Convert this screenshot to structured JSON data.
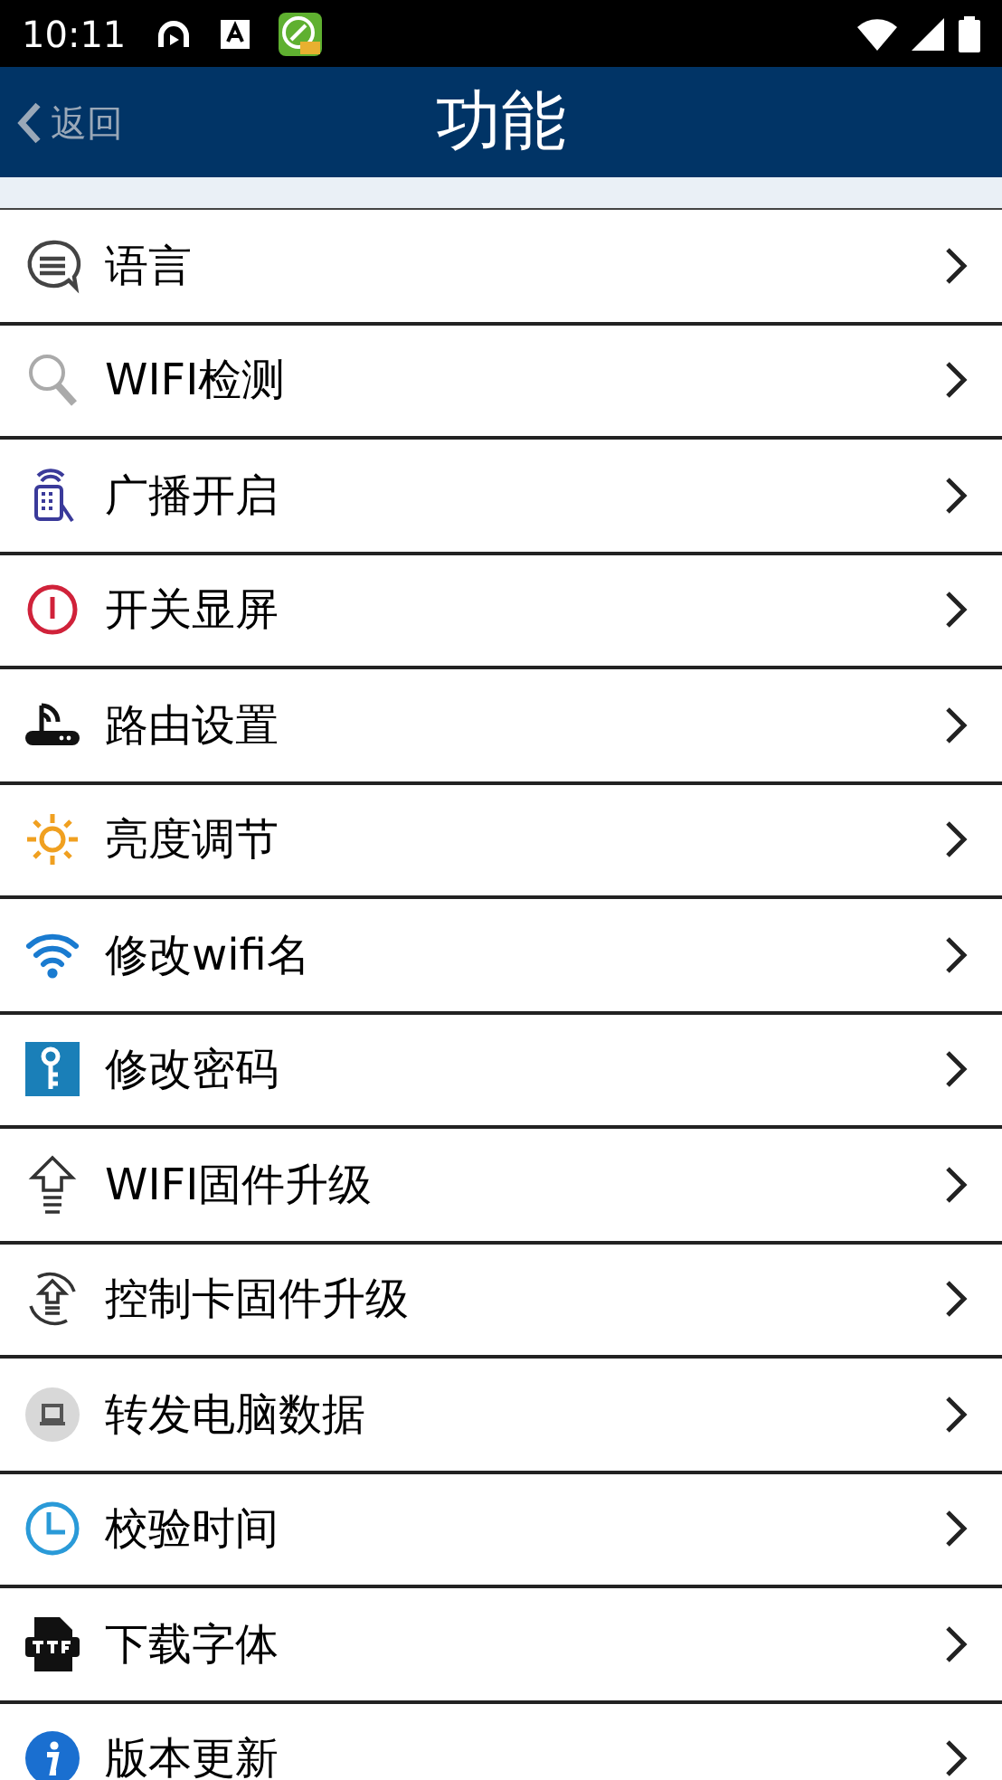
{
  "status_bar": {
    "time": "10:11"
  },
  "nav": {
    "back": "返回",
    "title": "功能"
  },
  "items": [
    {
      "kind": "chat",
      "label": "语言"
    },
    {
      "kind": "search",
      "label": "WIFI检测"
    },
    {
      "kind": "broadcast",
      "label": "广播开启"
    },
    {
      "kind": "power",
      "label": "开关显屏"
    },
    {
      "kind": "router",
      "label": "路由设置"
    },
    {
      "kind": "sun",
      "label": "亮度调节"
    },
    {
      "kind": "wifi",
      "label": "修改wifi名"
    },
    {
      "kind": "key",
      "label": "修改密码"
    },
    {
      "kind": "upload",
      "label": "WIFI固件升级"
    },
    {
      "kind": "sync",
      "label": "控制卡固件升级"
    },
    {
      "kind": "monitor",
      "label": "转发电脑数据"
    },
    {
      "kind": "clock",
      "label": "校验时间"
    },
    {
      "kind": "file",
      "label": "下载字体"
    },
    {
      "kind": "info",
      "label": "版本更新"
    }
  ]
}
